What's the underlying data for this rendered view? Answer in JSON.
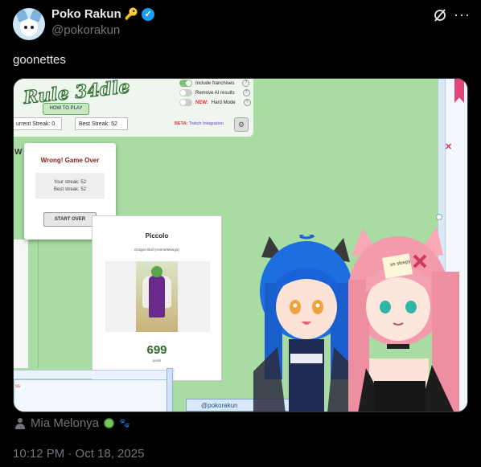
{
  "author": {
    "display_name": "Poko Rakun",
    "handle": "@pokorakun",
    "key_icon": "key-icon",
    "verified_icon": "verified-badge-icon"
  },
  "tweet": {
    "text": "goonettes",
    "timestamp": "10:12 PM · Oct 18, 2025"
  },
  "attribution": {
    "name": "Mia Melonya"
  },
  "media": {
    "game": {
      "logo": "Rule 34dle",
      "how_to_play": "HOW TO PLAY",
      "current_streak": "urrent Streak: 0",
      "best_streak": "Best Streak: 52",
      "beta_label": "BETA:",
      "twitch_label": "Twitch Integration",
      "toggles": [
        {
          "label": "Include franchises",
          "on": true
        },
        {
          "label": "Remove AI results",
          "on": false
        },
        {
          "label_new": "NEW:",
          "label": "Hard Mode",
          "on": false
        }
      ],
      "w_letter": "W",
      "modal": {
        "title": "Wrong! Game Over",
        "your_streak": "Your streak: 52",
        "best_streak": "Best streak: 52",
        "start_over": "START OVER"
      },
      "card": {
        "title": "Piccolo",
        "series": "Dragon Ball (Anime/Manga)",
        "count": "699",
        "count_label": "posts"
      }
    },
    "overlay": {
      "nameplate": "@pokorakun",
      "ss_text": "ss",
      "sleepy_note": "im sleepy"
    }
  },
  "colors": {
    "accent": "#1d9bf0",
    "game_bg": "#a8dca3",
    "modal_title": "#8b1a1a",
    "count": "#2e6b2e"
  }
}
